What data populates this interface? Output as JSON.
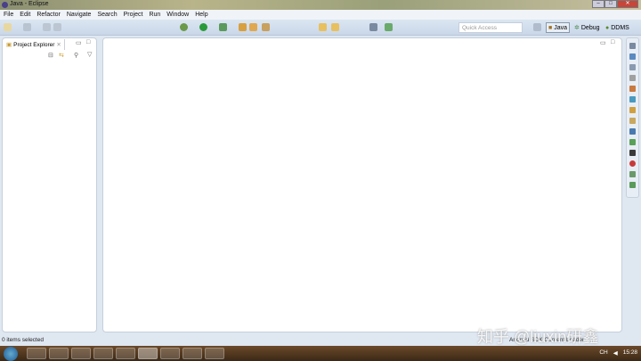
{
  "window": {
    "title": "Java - Eclipse"
  },
  "menu": [
    "File",
    "Edit",
    "Refactor",
    "Navigate",
    "Search",
    "Project",
    "Run",
    "Window",
    "Help"
  ],
  "toolbar": {
    "quick_access_placeholder": "Quick Access"
  },
  "perspectives": [
    {
      "label": "Java",
      "active": true
    },
    {
      "label": "Debug",
      "active": false
    },
    {
      "label": "DDMS",
      "active": false
    }
  ],
  "project_explorer": {
    "tab_label": "Project Explorer"
  },
  "status": {
    "left": "0 items selected",
    "right": "Android SDK Content Loader"
  },
  "watermark": "知乎 @liuxin研鑫",
  "taskbar": {
    "tray_lang": "CH",
    "clock": "15:28"
  },
  "colors": {
    "accent": "#c9d7e9",
    "close": "#c8453a"
  }
}
